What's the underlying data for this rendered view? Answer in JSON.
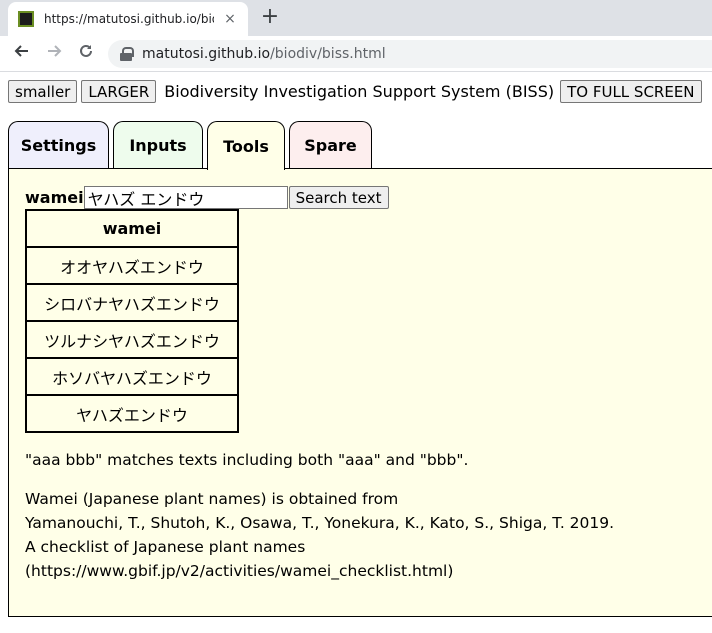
{
  "browser": {
    "tab_title": "https://matutosi.github.io/biodiv",
    "tab_close": "×",
    "new_tab": "+",
    "url_host": "matutosi.github.io",
    "url_path": "/biodiv/biss.html"
  },
  "header": {
    "smaller_label": "smaller",
    "larger_label": "LARGER",
    "title": "Biodiversity Investigation Support System (BISS)",
    "fullscreen_label": "TO FULL SCREEN"
  },
  "tabs": [
    {
      "label": "Settings",
      "color": "#efeffc"
    },
    {
      "label": "Inputs",
      "color": "#eefced"
    },
    {
      "label": "Tools",
      "color": "#ffffe8",
      "active": true
    },
    {
      "label": "Spare",
      "color": "#fdeeee"
    }
  ],
  "search": {
    "label": "wamei",
    "value": "ヤハズ エンドウ",
    "button_label": "Search text"
  },
  "results": {
    "header": "wamei",
    "rows": [
      "オオヤハズエンドウ",
      "シロバナヤハズエンドウ",
      "ツルナシヤハズエンドウ",
      "ホソバヤハズエンドウ",
      "ヤハズエンドウ"
    ]
  },
  "notes": {
    "match_hint": "\"aaa bbb\" matches texts including both \"aaa\" and \"bbb\".",
    "source_lines": [
      "Wamei (Japanese plant names) is obtained from",
      "Yamanouchi, T., Shutoh, K., Osawa, T., Yonekura, K., Kato, S., Shiga, T. 2019.",
      "A checklist of Japanese plant names",
      "(https://www.gbif.jp/v2/activities/wamei_checklist.html)"
    ]
  }
}
